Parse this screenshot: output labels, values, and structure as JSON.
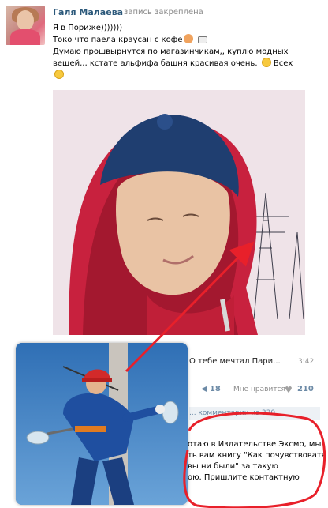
{
  "post": {
    "author": "Галя Малаева",
    "pinned_label": "запись закреплена",
    "lines": [
      "Я в Пориже)))))))",
      "Токо что паела краусан с кофе",
      "Думаю прошвырнутся по магазинчикам,, куплю модных",
      "вещей,,, кстате альфифа башня красивая очень.",
      "Всех"
    ]
  },
  "emoji": {
    "hand": "hand-emoji",
    "cup": "coffee-emoji",
    "smile": "smile-emoji",
    "kiss": "kiss-emoji"
  },
  "comment_preview": {
    "text": "О тебе мечтал Пари...",
    "time": "3:42"
  },
  "actions": {
    "shares_count": "18",
    "like_label": "Мне нравится",
    "likes_count": "210"
  },
  "other_comments_label": "... комментарии из 330",
  "comment_body_lines": [
    "отаю в Издательстве Эксмо, мы",
    "ть вам книгу \"Как почувствовать",
    "вы ни были\" за такую",
    "ою. Пришлите контактную"
  ],
  "colors": {
    "author_link": "#2b587a",
    "annotation_red": "#e8202a",
    "meta_gray": "#8a8a8a"
  }
}
